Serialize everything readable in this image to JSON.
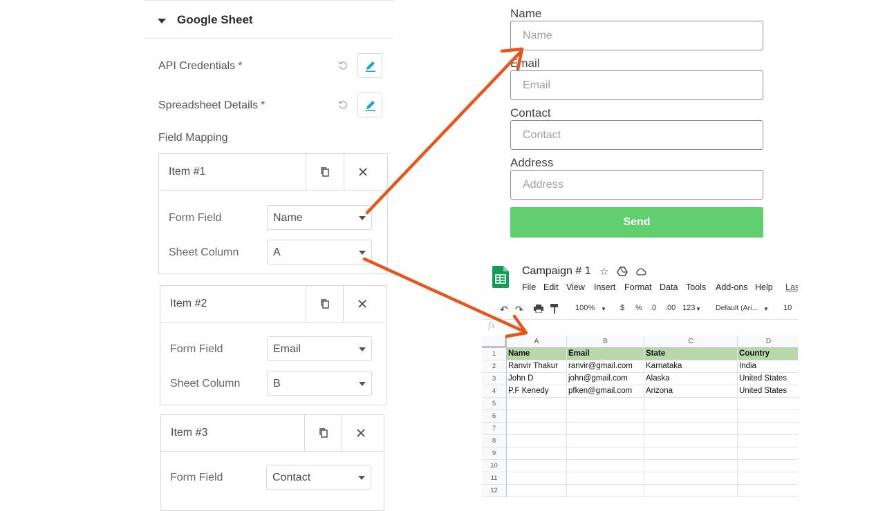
{
  "panel": {
    "section_title": "Google Sheet",
    "api_credentials_label": "API Credentials",
    "spreadsheet_details_label": "Spreadsheet Details",
    "required_mark": "*",
    "field_mapping_label": "Field Mapping",
    "form_field_label": "Form Field",
    "sheet_column_label": "Sheet Column",
    "items": [
      {
        "title": "Item #1",
        "form_field": "Name",
        "sheet_column": "A"
      },
      {
        "title": "Item #2",
        "form_field": "Email",
        "sheet_column": "B"
      },
      {
        "title": "Item #3",
        "form_field": "Contact"
      }
    ]
  },
  "form": {
    "fields": [
      {
        "label": "Name",
        "placeholder": "Name"
      },
      {
        "label": "Email",
        "placeholder": "Email"
      },
      {
        "label": "Contact",
        "placeholder": "Contact"
      },
      {
        "label": "Address",
        "placeholder": "Address"
      }
    ],
    "submit_label": "Send",
    "submit_color": "#61ce70"
  },
  "sheet": {
    "title": "Campaign # 1",
    "menu": [
      "File",
      "Edit",
      "View",
      "Insert",
      "Format",
      "Data",
      "Tools",
      "Add-ons",
      "Help",
      "Las"
    ],
    "toolbar": {
      "zoom": "100%",
      "currency": "$",
      "percent": "%",
      "dec_less": ".0",
      "dec_more": ".00",
      "more_formats": "123",
      "font": "Default (Ari...",
      "font_size": "10"
    },
    "formula_icon": "fx",
    "columns": [
      "A",
      "B",
      "C",
      "D"
    ],
    "row_numbers": [
      "1",
      "2",
      "3",
      "4",
      "5",
      "6",
      "7",
      "8",
      "9",
      "10",
      "11",
      "12"
    ],
    "header_row": [
      "Name",
      "Email",
      "State",
      "Country"
    ],
    "rows": [
      [
        "Ranvir Thakur",
        "ranvir@gmail.com",
        "Karnataka",
        "India"
      ],
      [
        "John D",
        "john@gmail.com",
        "Alaska",
        "United States"
      ],
      [
        "P.F Kenedy",
        "pfken@gmail.com",
        "Arizona",
        "United States"
      ]
    ],
    "header_color": "#b7d7a8"
  },
  "annotations": {
    "arrow_color": "#e8541a"
  }
}
